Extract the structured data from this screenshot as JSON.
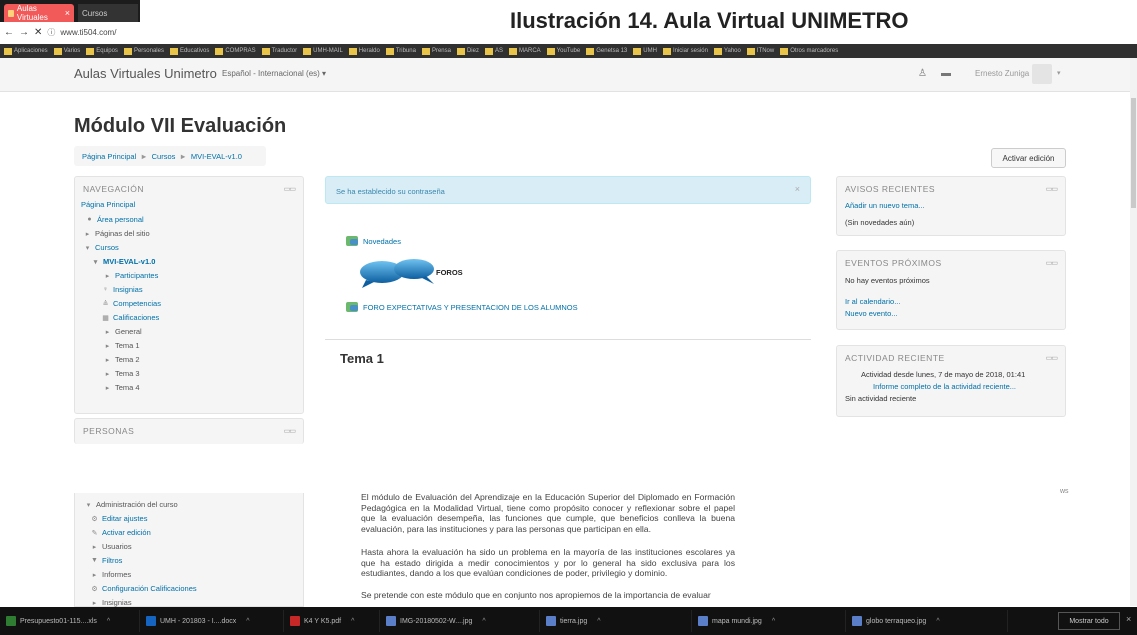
{
  "caption": "Ilustración 14. Aula Virtual UNIMETRO",
  "browser": {
    "tabs": [
      {
        "label": "Aulas Virtuales",
        "close": "×"
      },
      {
        "label": "Cursos"
      }
    ],
    "url": "www.ti504.com/",
    "bookmarks": [
      "Aplicaciones",
      "Varios",
      "Equipos",
      "Personales",
      "Educativos",
      "COMPRAS",
      "Traductor",
      "UMH-MAIL",
      "Heraldo",
      "Tribuna",
      "Prensa",
      "Diez",
      "AS",
      "MARCA",
      "YouTube",
      "Genetsa 13",
      "UMH",
      "Iniciar sesión",
      "Yahoo",
      "ITNow",
      "Otros marcadores"
    ]
  },
  "header": {
    "site_name": "Aulas Virtuales Unimetro",
    "language": "Español - Internacional (es) ▾",
    "user_name": "Ernesto Zuniga",
    "user_caret": "▾"
  },
  "page": {
    "title": "Módulo VII Evaluación",
    "breadcrumb": [
      "Página Principal",
      "Cursos",
      "MVI-EVAL-v1.0"
    ],
    "breadcrumb_sep": "►",
    "edit_button": "Activar edición"
  },
  "navigation": {
    "title": "NAVEGACIÓN",
    "ctrl": "▭▭",
    "items": [
      {
        "label": "Página Principal",
        "icon": ""
      },
      {
        "label": "Área personal",
        "icon": "●"
      },
      {
        "label": "Páginas del sitio",
        "icon": "▸"
      },
      {
        "label": "Cursos",
        "icon": "▾"
      },
      {
        "label": "MVI-EVAL-v1.0",
        "icon": "▾"
      },
      {
        "label": "Participantes",
        "icon": "▸"
      },
      {
        "label": "Insignias",
        "icon": "♀"
      },
      {
        "label": "Competencias",
        "icon": "≜"
      },
      {
        "label": "Calificaciones",
        "icon": "▦"
      },
      {
        "label": "General",
        "icon": "▸"
      },
      {
        "label": "Tema 1",
        "icon": "▸"
      },
      {
        "label": "Tema 2",
        "icon": "▸"
      },
      {
        "label": "Tema 3",
        "icon": "▸"
      },
      {
        "label": "Tema 4",
        "icon": "▸"
      }
    ]
  },
  "people": {
    "title": "PERSONAS",
    "ctrl": "▭▭"
  },
  "alert": {
    "message": "Se ha establecido su contraseña",
    "close": "×"
  },
  "activities": {
    "news": "Novedades",
    "foros_label": "FOROS",
    "forum": "FORO EXPECTATIVAS Y PRESENTACION DE LOS ALUMNOS"
  },
  "section_title": "Tema 1",
  "avisos": {
    "title": "AVISOS RECIENTES",
    "ctrl": "▭▭",
    "add": "Añadir un nuevo tema...",
    "empty": "(Sin novedades aún)"
  },
  "eventos": {
    "title": "EVENTOS PRÓXIMOS",
    "ctrl": "▭▭",
    "empty": "No hay eventos próximos",
    "calendar": "Ir al calendario...",
    "new_event": "Nuevo evento..."
  },
  "actividad": {
    "title": "ACTIVIDAD RECIENTE",
    "ctrl": "▭▭",
    "since": "Actividad desde lunes, 7 de mayo de 2018, 01:41",
    "report": "Informe completo de la actividad reciente...",
    "empty": "Sin actividad reciente"
  },
  "admin": {
    "items": [
      {
        "label": "Administración del curso",
        "icon": "▾"
      },
      {
        "label": "Editar ajustes",
        "icon": "⚙"
      },
      {
        "label": "Activar edición",
        "icon": "✎"
      },
      {
        "label": "Usuarios",
        "icon": "▸"
      },
      {
        "label": "Filtros",
        "icon": "▼"
      },
      {
        "label": "Informes",
        "icon": "▸"
      },
      {
        "label": "Configuración Calificaciones",
        "icon": "⚙"
      },
      {
        "label": "Insignias",
        "icon": "▸"
      }
    ]
  },
  "description": {
    "p1": "El módulo de Evaluación del Aprendizaje en la Educación Superior del Diplomado en Formación Pedagógica en la Modalidad Virtual, tiene como propósito conocer y reflexionar sobre el papel que la evaluación desempeña, las funciones que cumple, que beneficios conlleva la buena evaluación, para las instituciones y para las personas que participan en ella.",
    "p2": "Hasta ahora la evaluación ha sido un problema en la mayoría de las instituciones escolares ya que ha estado dirigida a medir conocimientos y por lo general ha sido exclusiva para los estudiantes, dando a los que evalúan condiciones de poder, privilegio y dominio.",
    "p3": "Se pretende con este módulo que en conjunto nos apropiemos de la importancia de evaluar"
  },
  "marker": "ws",
  "taskbar": {
    "items": [
      {
        "label": "Presupuesto01-115....xls",
        "color": "#2e7d32"
      },
      {
        "label": "UMH - 201803 - I....docx",
        "color": "#1565c0"
      },
      {
        "label": "K4 Y K5.pdf",
        "color": "#c62828"
      },
      {
        "label": "IMG-20180502-W....jpg",
        "color": "#5b7ec9"
      },
      {
        "label": "tierra.jpg",
        "color": "#5b7ec9"
      },
      {
        "label": "mapa mundi.jpg",
        "color": "#5b7ec9"
      },
      {
        "label": "globo terraqueo.jpg",
        "color": "#5b7ec9"
      }
    ],
    "caret": "^",
    "show_all": "Mostrar todo",
    "close": "×"
  }
}
